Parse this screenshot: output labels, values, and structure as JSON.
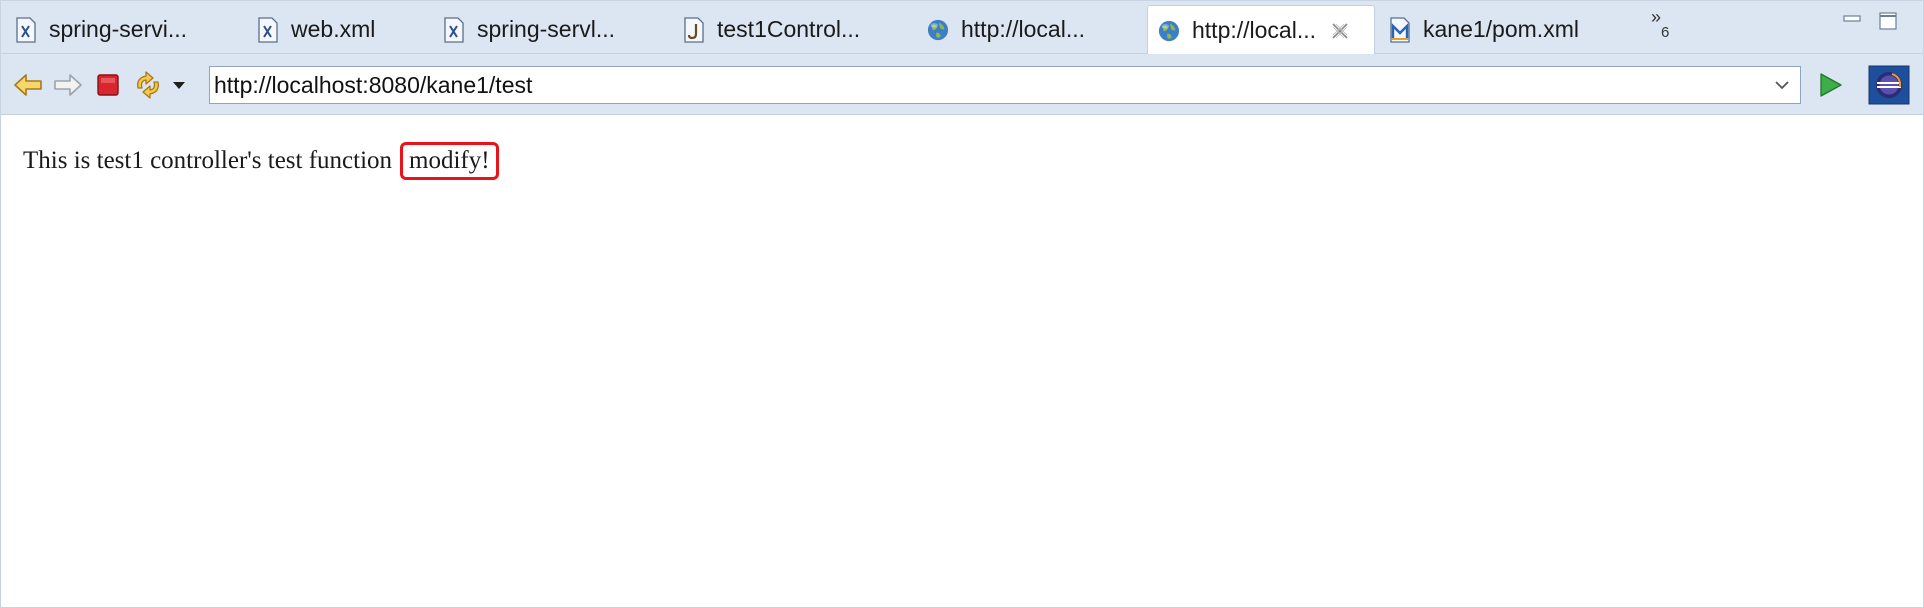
{
  "tabs": [
    {
      "label": "spring-servi...",
      "icon": "xml-file-icon"
    },
    {
      "label": "web.xml",
      "icon": "xml-file-icon"
    },
    {
      "label": "spring-servl...",
      "icon": "xml-file-icon"
    },
    {
      "label": "test1Control...",
      "icon": "java-file-icon"
    },
    {
      "label": "http://local...",
      "icon": "globe-icon"
    },
    {
      "label": "http://local...",
      "icon": "globe-icon",
      "active": true
    },
    {
      "label": "kane1/pom.xml",
      "icon": "maven-file-icon"
    }
  ],
  "overflow": {
    "glyph": "»",
    "count": "6"
  },
  "toolbar": {
    "url": "http://localhost:8080/kane1/test"
  },
  "content": {
    "text": "This is test1 controller's test function",
    "highlight": "modify!"
  },
  "colors": {
    "chrome": "#dce6f2",
    "highlight_border": "#e8141a"
  }
}
